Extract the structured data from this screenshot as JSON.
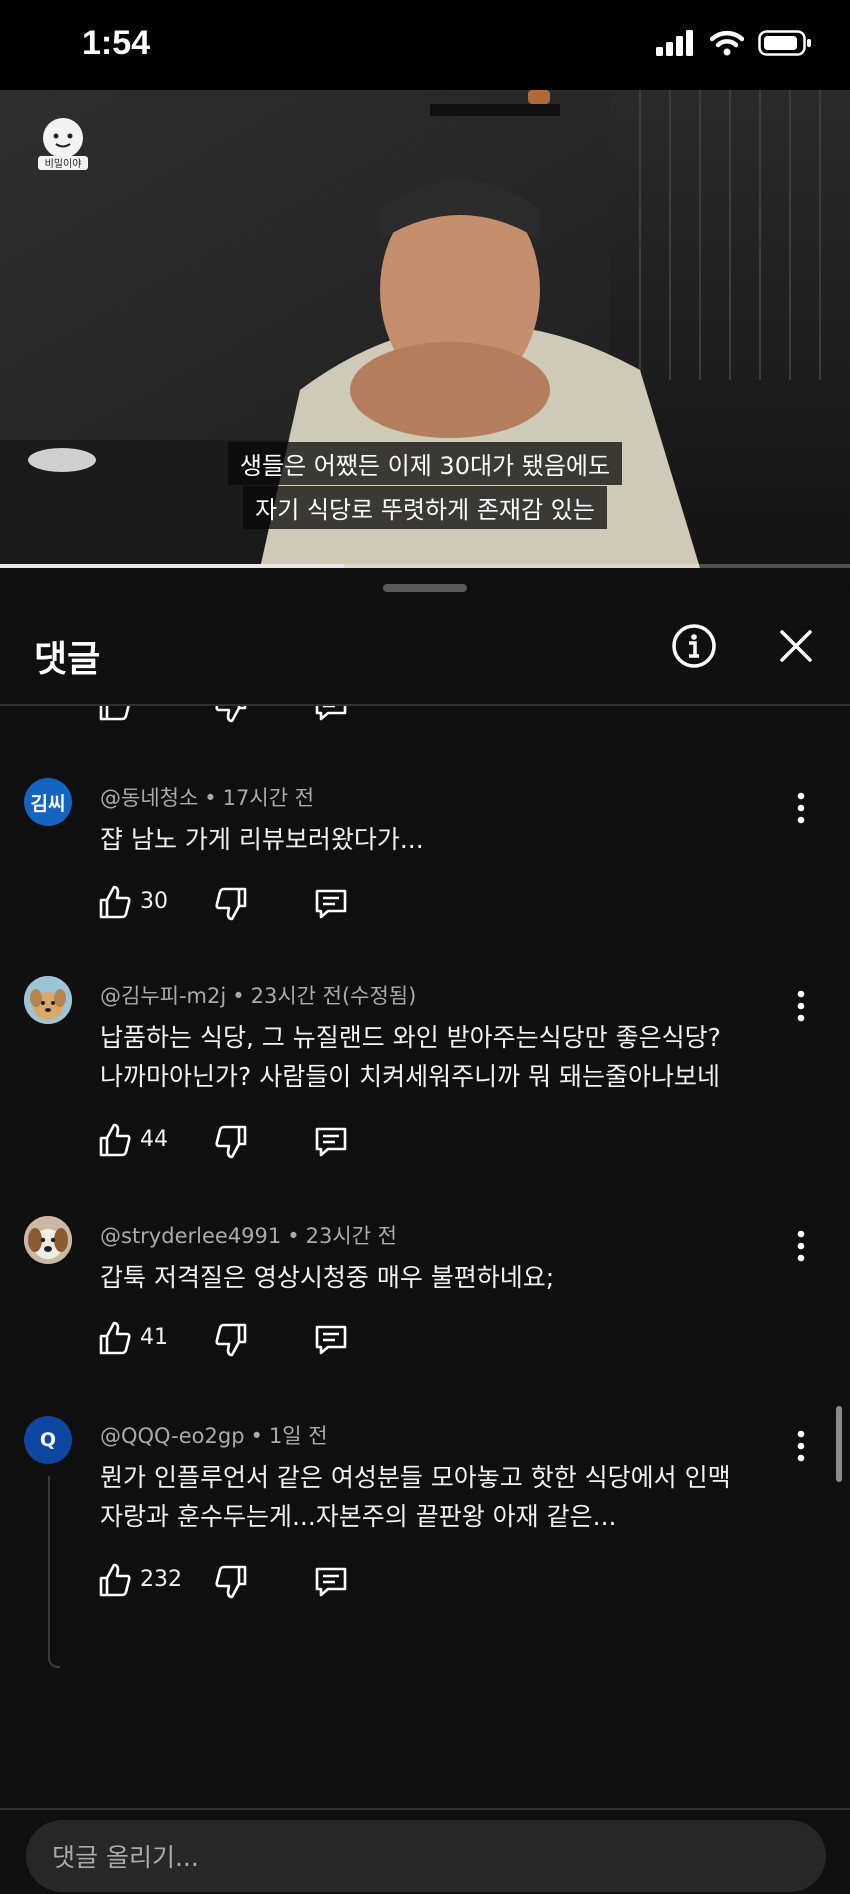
{
  "status_bar": {
    "time": "1:54"
  },
  "video": {
    "subtitle_line1": "생들은 어쨌든 이제 30대가 됐음에도",
    "subtitle_line2": "자기 식당로 뚜렷하게 존재감 있는",
    "channel_logo_text": "비밀이야",
    "progress_fraction": 0.405
  },
  "comments_panel": {
    "title": "댓글",
    "input_placeholder": "댓글 올리기..."
  },
  "comments": [
    {
      "author": "@동네청소",
      "time": "17시간 전",
      "avatar_text": "김씨",
      "avatar_color": "#1565c0",
      "lines": [
        "쟙 남노 가게 리뷰보러왔다가..."
      ],
      "likes": "30"
    },
    {
      "author": "@김누피-m2j",
      "time": "23시간 전(수정됨)",
      "avatar_text": "",
      "avatar_color": "#8fb6c9",
      "lines": [
        "납품하는 식당, 그 뉴질랜드 와인 받아주는식당만 좋은식당?",
        "나까마아닌가? 사람들이 치켜세워주니까 뭐 돼는줄아나보네"
      ],
      "likes": "44"
    },
    {
      "author": "@stryderlee4991",
      "time": "23시간 전",
      "avatar_text": "",
      "avatar_color": "#b79a78",
      "lines": [
        "갑툭 저격질은 영상시청중 매우 불편하네요;"
      ],
      "likes": "41"
    },
    {
      "author": "@QQQ-eo2gp",
      "time": "1일 전",
      "avatar_text": "Q",
      "avatar_color": "#0d47a1",
      "lines": [
        "뭔가 인플루언서 같은 여성분들 모아놓고 핫한 식당에서 인맥",
        "자랑과 훈수두는게...자본주의 끝판왕 아재 같은..."
      ],
      "likes": "232"
    }
  ]
}
